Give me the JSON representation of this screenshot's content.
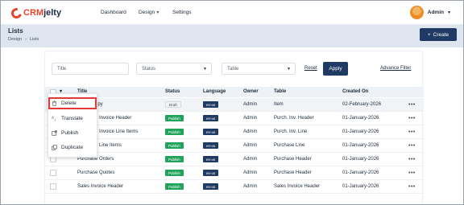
{
  "app": {
    "logo_prefix": "CRM",
    "logo_suffix": "jelty"
  },
  "nav": {
    "dashboard": "Dashboard",
    "design": "Design",
    "settings": "Settings"
  },
  "user": {
    "name": "Admin"
  },
  "page": {
    "title": "Lists",
    "breadcrumb": [
      "Design",
      "Lists"
    ],
    "create_label": "Create"
  },
  "filters": {
    "title_placeholder": "Title",
    "status_placeholder": "Status",
    "table_placeholder": "Table",
    "reset_label": "Reset",
    "apply_label": "Apply",
    "advance_label": "Advance Filter"
  },
  "table": {
    "columns": [
      "Title",
      "Status",
      "Language",
      "Owner",
      "Table",
      "Created On"
    ],
    "rows": [
      {
        "title": "opy",
        "status": "Draft",
        "language": "en-us",
        "owner": "Admin",
        "table": "Item",
        "created": "02-February-2026"
      },
      {
        "title": "e Invoice Header",
        "status": "Publish",
        "language": "en-us",
        "owner": "Admin",
        "table": "Purch. Inv. Header",
        "created": "01-January-2026"
      },
      {
        "title": "e Invoice Line Items",
        "status": "Publish",
        "language": "en-us",
        "owner": "Admin",
        "table": "Purch. Inv. Line",
        "created": "01-January-2026"
      },
      {
        "title": "Purchase Line Items",
        "status": "Publish",
        "language": "en-us",
        "owner": "Admin",
        "table": "Purchase Line",
        "created": "01-January-2026"
      },
      {
        "title": "Purchase Orders",
        "status": "Publish",
        "language": "en-us",
        "owner": "Admin",
        "table": "Purchase Header",
        "created": "01-January-2026"
      },
      {
        "title": "Purchase Quotes",
        "status": "Publish",
        "language": "en-us",
        "owner": "Admin",
        "table": "Purchase Header",
        "created": "01-January-2026"
      },
      {
        "title": "Sales Invoice Header",
        "status": "Publish",
        "language": "en-us",
        "owner": "Admin",
        "table": "Sales Invoice Header",
        "created": "01-January-2026"
      }
    ]
  },
  "context_menu": {
    "items": [
      "Delete",
      "Translate",
      "Publish",
      "Duplicate"
    ]
  },
  "colors": {
    "brand_navy": "#1f3a63",
    "brand_red": "#e2452e",
    "publish_green": "#22a35b",
    "highlight_red": "#e53935"
  }
}
